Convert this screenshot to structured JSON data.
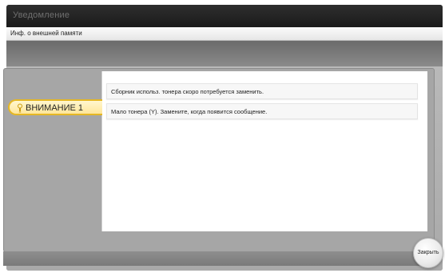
{
  "window": {
    "title": "Уведомление"
  },
  "header": {
    "subtitle": "Инф. о внешней памяти"
  },
  "tab": {
    "label": "ВНИМАНИЕ 1",
    "icon": "warning-bulb-icon",
    "accent": "#e5b724"
  },
  "messages": [
    {
      "text": "Сборник использ. тонера скоро потребуется заменить."
    },
    {
      "text": "Мало тонера (Y). Замените, когда появится сообщение."
    }
  ],
  "footer": {
    "close_label": "Закрыть"
  }
}
